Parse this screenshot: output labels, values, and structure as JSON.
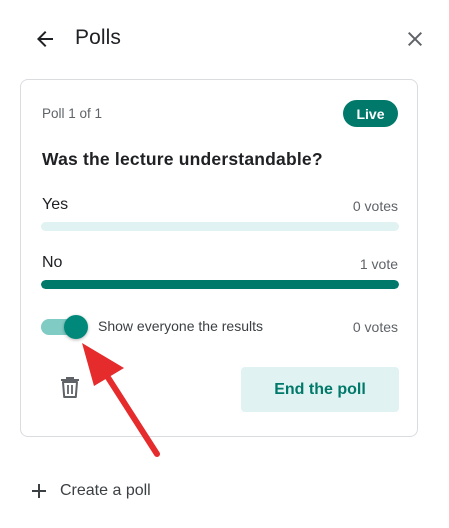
{
  "header": {
    "title": "Polls",
    "back_icon": "arrow-back-icon",
    "close_icon": "close-icon"
  },
  "poll": {
    "count_label": "Poll 1 of 1",
    "status_badge": "Live",
    "question": "Was the lecture understandable?",
    "options": [
      {
        "label": "Yes",
        "votes": "0 votes",
        "share": 0
      },
      {
        "label": "No",
        "votes": "1 vote",
        "share": 1
      }
    ],
    "show_results": {
      "label": "Show everyone the results",
      "enabled": true
    },
    "total_votes": "0 votes",
    "delete_icon": "trash-icon",
    "end_button": "End the poll"
  },
  "footer": {
    "create_label": "Create a poll",
    "create_icon": "plus-icon"
  },
  "annotation": {
    "arrow_color": "#e52b2b"
  },
  "colors": {
    "accent": "#00796b",
    "accent_light": "#e0f2f1",
    "toggle_track": "#80cbc4"
  }
}
